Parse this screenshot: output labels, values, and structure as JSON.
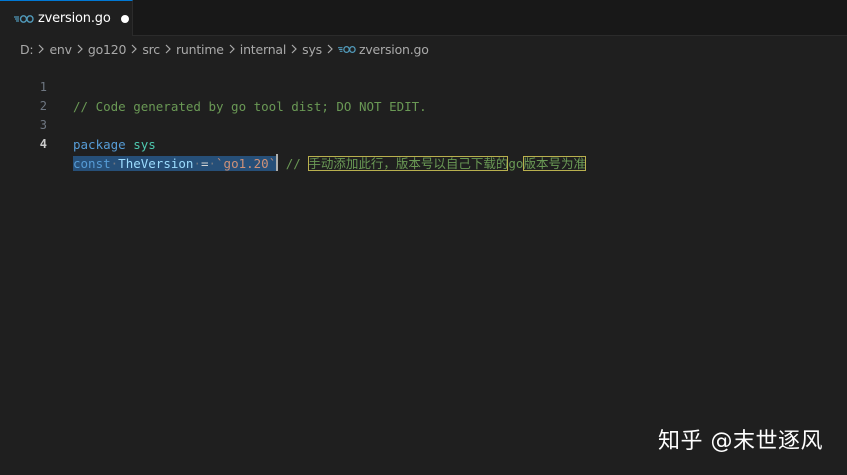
{
  "tab": {
    "filename": "zversion.go",
    "icon": "go-file-icon",
    "dirty": true,
    "accent": "#0078d4"
  },
  "breadcrumb": {
    "items": [
      "D:",
      "env",
      "go120",
      "src",
      "runtime",
      "internal",
      "sys"
    ],
    "file": "zversion.go"
  },
  "editor": {
    "lines": [
      {
        "number": "1",
        "comment": "// Code generated by go tool dist; DO NOT EDIT."
      },
      {
        "number": "2"
      },
      {
        "number": "3",
        "keyword": "package",
        "name": "sys"
      },
      {
        "number": "4",
        "keyword": "const",
        "name": "TheVersion",
        "operator": "=",
        "value": "`go1.20`",
        "comment_prefix": "//",
        "note_part1": "手动添加此行，版本号以自己下载的",
        "note_mid": "go",
        "note_part2": "版本号为准"
      }
    ],
    "active_line": "4"
  },
  "watermark": {
    "text": "知乎 @末世逐风"
  },
  "colors": {
    "background": "#1f1f1f",
    "comment": "#6a9955",
    "keyword": "#569cd6",
    "selection": "#264f78",
    "string": "#ce9178",
    "highlight_box": "#b9b04e"
  }
}
